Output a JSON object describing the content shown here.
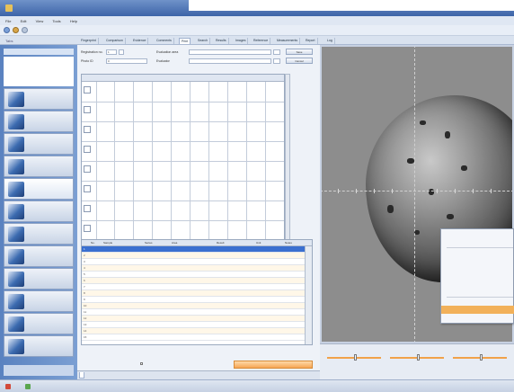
{
  "window": {
    "title": ""
  },
  "menu": {
    "items": [
      "File",
      "Edit",
      "View",
      "Tools",
      "Help"
    ]
  },
  "tabs": {
    "prefix_label": "Tabs",
    "items": [
      "Fingerprint",
      "Comparison",
      "Evidence",
      "Comments",
      "Print",
      "Search",
      "Results",
      "Images",
      "Reference",
      "Measurements",
      "Report",
      "Log"
    ],
    "active_index": 4
  },
  "sidebar": {
    "header": "",
    "items": [
      "",
      "",
      "",
      "",
      "",
      "",
      "",
      "",
      "",
      "",
      "",
      "",
      ""
    ]
  },
  "form": {
    "registration_label": "Registration no.",
    "registration_value": "1",
    "evaluation_label": "Evaluation area",
    "evaluation_value": "",
    "photo_label": "Photo ID",
    "photo_value": "0",
    "evaluator_label": "Evaluator",
    "evaluator_value": "",
    "button_1": "Save",
    "button_2": "Cancel"
  },
  "grid": {
    "columns": [
      "",
      "",
      "",
      "",
      "",
      "",
      "",
      "",
      "",
      "",
      ""
    ],
    "rows": 10
  },
  "table": {
    "headers": [
      "No.",
      "Sample",
      "Series",
      "Area",
      "Result",
      "Unit",
      "Notes"
    ],
    "row_numbers": [
      "1",
      "2",
      "3",
      "4",
      "5",
      "6",
      "7",
      "8",
      "9",
      "10",
      "11",
      "12",
      "13",
      "14",
      "15"
    ],
    "selected_index": 0
  },
  "actions": {
    "checkbox_label": "",
    "orange_button": ""
  },
  "bottom_tabs": [
    "",
    "",
    ""
  ],
  "context_menu": {
    "items": [
      "",
      "",
      "",
      "",
      "",
      "",
      "",
      "",
      "",
      "",
      "",
      ""
    ],
    "highlighted_index": 10
  },
  "slider_labels": [
    "",
    "",
    "",
    "",
    "",
    "",
    "",
    "",
    ""
  ],
  "status": {
    "text_1": "",
    "text_2": "",
    "text_3": "",
    "text_4": ""
  },
  "colors": {
    "titlebar": "#3d64a8",
    "accent_orange": "#f2b15a",
    "selection_blue": "#3a6fd0"
  }
}
